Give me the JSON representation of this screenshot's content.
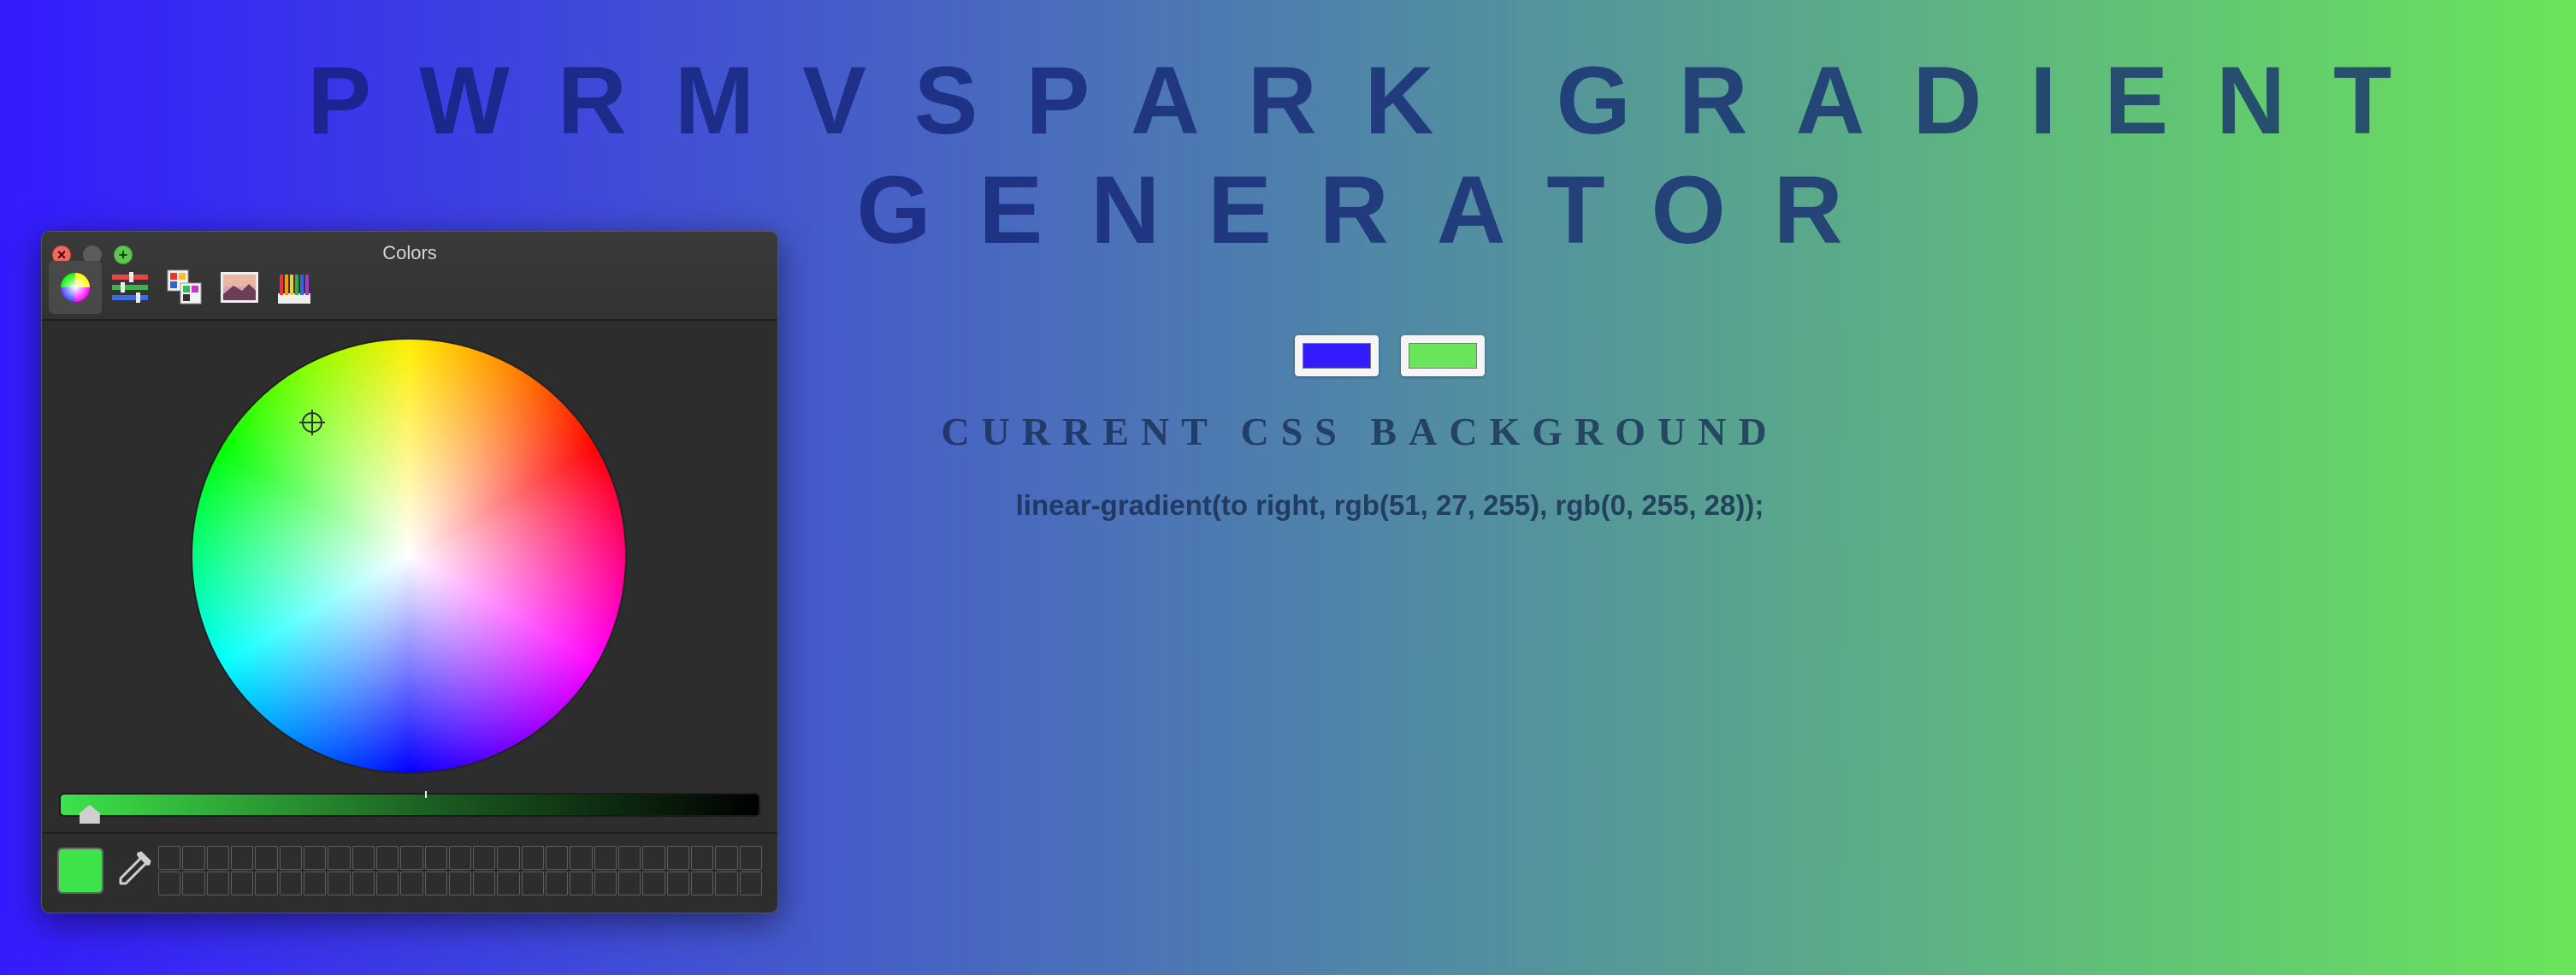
{
  "page": {
    "title": "PWRMVSPARK GRADIENT GENERATOR",
    "subheading": "CURRENT CSS BACKGROUND",
    "css_value": "linear-gradient(to right, rgb(51, 27, 255), rgb(0, 255, 28));",
    "gradient": {
      "start_color": "#331bff",
      "end_color": "#6ae45a"
    },
    "swatches": [
      {
        "color": "#331bff"
      },
      {
        "color": "#6ae45a"
      }
    ]
  },
  "colors_panel": {
    "title": "Colors",
    "tabs": [
      {
        "name": "color-wheel-icon",
        "active": true
      },
      {
        "name": "color-sliders-icon",
        "active": false
      },
      {
        "name": "color-palettes-icon",
        "active": false
      },
      {
        "name": "image-palettes-icon",
        "active": false
      },
      {
        "name": "pencils-icon",
        "active": false
      }
    ],
    "current_color": "#3ee24a",
    "brightness_fraction": 0.02,
    "swatch_slots": {
      "rows": 2,
      "columns": 25
    }
  }
}
